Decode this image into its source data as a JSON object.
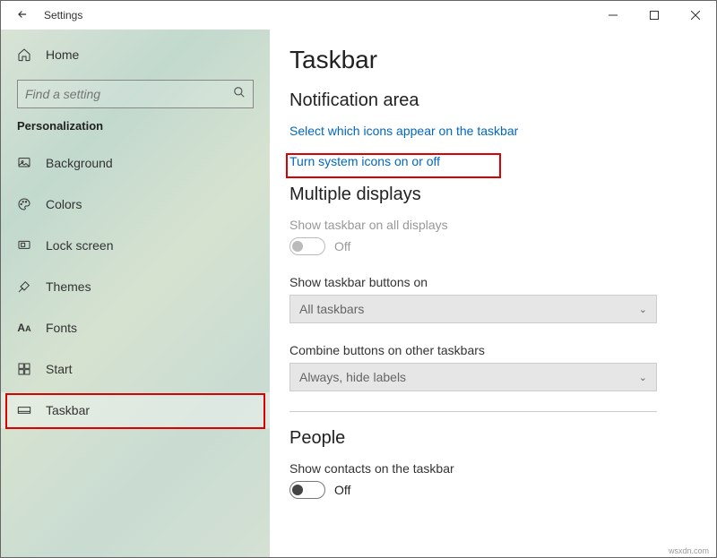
{
  "window": {
    "title": "Settings"
  },
  "sidebar": {
    "home": "Home",
    "search_placeholder": "Find a setting",
    "category": "Personalization",
    "items": [
      {
        "label": "Background"
      },
      {
        "label": "Colors"
      },
      {
        "label": "Lock screen"
      },
      {
        "label": "Themes"
      },
      {
        "label": "Fonts"
      },
      {
        "label": "Start"
      },
      {
        "label": "Taskbar"
      }
    ]
  },
  "content": {
    "title": "Taskbar",
    "notification": {
      "heading": "Notification area",
      "link1": "Select which icons appear on the taskbar",
      "link2": "Turn system icons on or off"
    },
    "multiple": {
      "heading": "Multiple displays",
      "show_all_label": "Show taskbar on all displays",
      "show_all_state": "Off",
      "buttons_on_label": "Show taskbar buttons on",
      "buttons_on_value": "All taskbars",
      "combine_label": "Combine buttons on other taskbars",
      "combine_value": "Always, hide labels"
    },
    "people": {
      "heading": "People",
      "contacts_label": "Show contacts on the taskbar",
      "contacts_state": "Off"
    }
  },
  "watermark": "wsxdn.com"
}
